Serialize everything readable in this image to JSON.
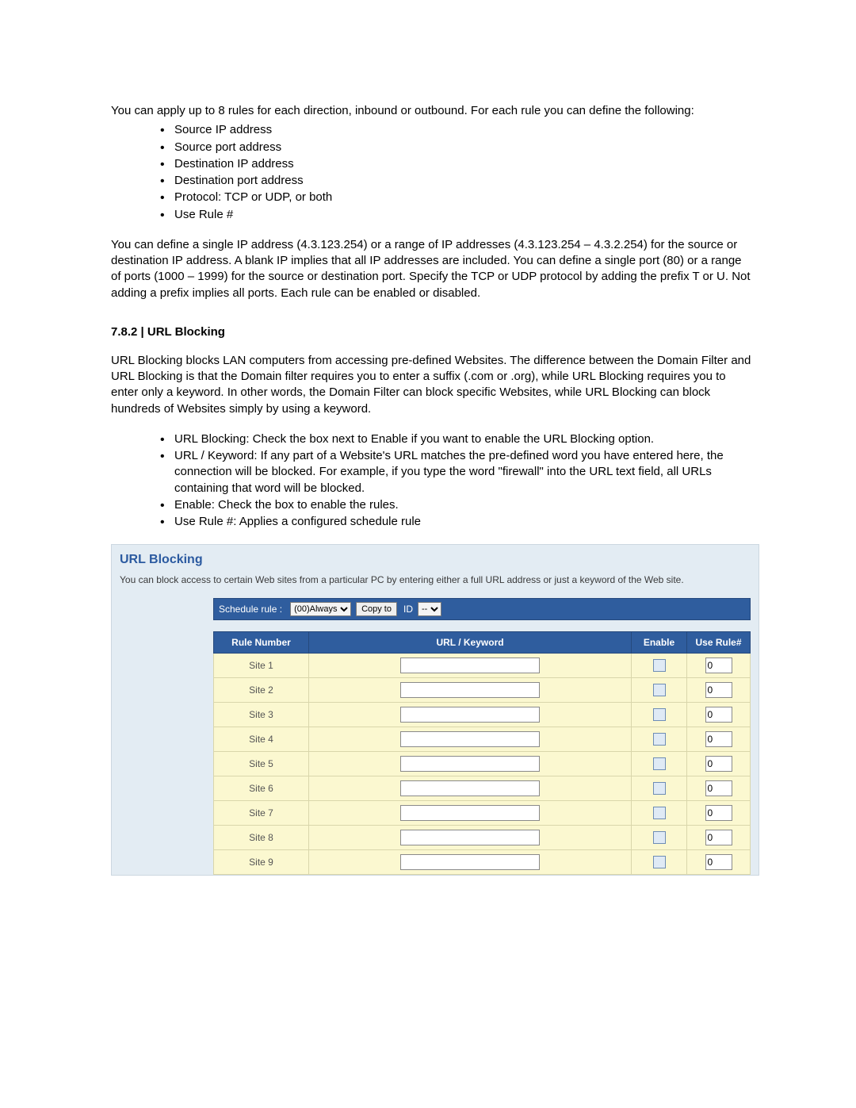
{
  "intro": {
    "para1": "You can apply up to 8 rules for each direction, inbound or outbound. For each rule you can define the following:",
    "defs": [
      "Source IP address",
      "Source port address",
      "Destination IP address",
      "Destination port address",
      "Protocol:  TCP or UDP, or both",
      "Use Rule #"
    ],
    "para2": "You can define a single IP address (4.3.123.254) or a range of IP addresses (4.3.123.254 – 4.3.2.254) for the source or destination IP address. A blank IP implies that all IP addresses are included. You can define a single port (80) or a range of ports (1000 – 1999) for the source or destination port. Specify the TCP or UDP protocol by adding the prefix T or U. Not adding a prefix implies all ports. Each rule can be enabled or disabled."
  },
  "section": {
    "heading": "7.8.2 | URL Blocking",
    "para1": "URL Blocking blocks LAN computers from accessing pre-defined Websites. The difference between the Domain Filter and URL Blocking is that the Domain filter requires you to enter a suffix (.com or .org), while URL Blocking requires you to enter only a keyword. In other words, the Domain Filter can block specific Websites, while URL Blocking can block hundreds of Websites simply by using a keyword.",
    "bullets": [
      "URL Blocking: Check the box next to Enable if you want to enable the URL Blocking option.",
      "URL / Keyword: If any part of a Website's URL matches the pre-defined word you have entered here, the connection will be blocked. For example, if you type the word \"firewall\" into the URL text field, all URLs containing that word will be blocked.",
      "Enable: Check the box to enable the rules.",
      "Use Rule #: Applies a configured schedule rule"
    ]
  },
  "panel": {
    "title": "URL Blocking",
    "desc": "You can block access to certain Web sites from a particular PC by entering either a full URL address or just a keyword of the Web site.",
    "schedule": {
      "label": "Schedule rule :",
      "select_value": "(00)Always",
      "copy_btn": "Copy to",
      "id_label": "ID",
      "id_value": "--"
    },
    "headers": {
      "rule": "Rule Number",
      "url": "URL / Keyword",
      "enable": "Enable",
      "use": "Use Rule#"
    },
    "rows": [
      {
        "rule": "Site 1",
        "url": "",
        "enable": false,
        "use": "0"
      },
      {
        "rule": "Site 2",
        "url": "",
        "enable": false,
        "use": "0"
      },
      {
        "rule": "Site 3",
        "url": "",
        "enable": false,
        "use": "0"
      },
      {
        "rule": "Site 4",
        "url": "",
        "enable": false,
        "use": "0"
      },
      {
        "rule": "Site 5",
        "url": "",
        "enable": false,
        "use": "0"
      },
      {
        "rule": "Site 6",
        "url": "",
        "enable": false,
        "use": "0"
      },
      {
        "rule": "Site 7",
        "url": "",
        "enable": false,
        "use": "0"
      },
      {
        "rule": "Site 8",
        "url": "",
        "enable": false,
        "use": "0"
      },
      {
        "rule": "Site 9",
        "url": "",
        "enable": false,
        "use": "0"
      }
    ]
  }
}
